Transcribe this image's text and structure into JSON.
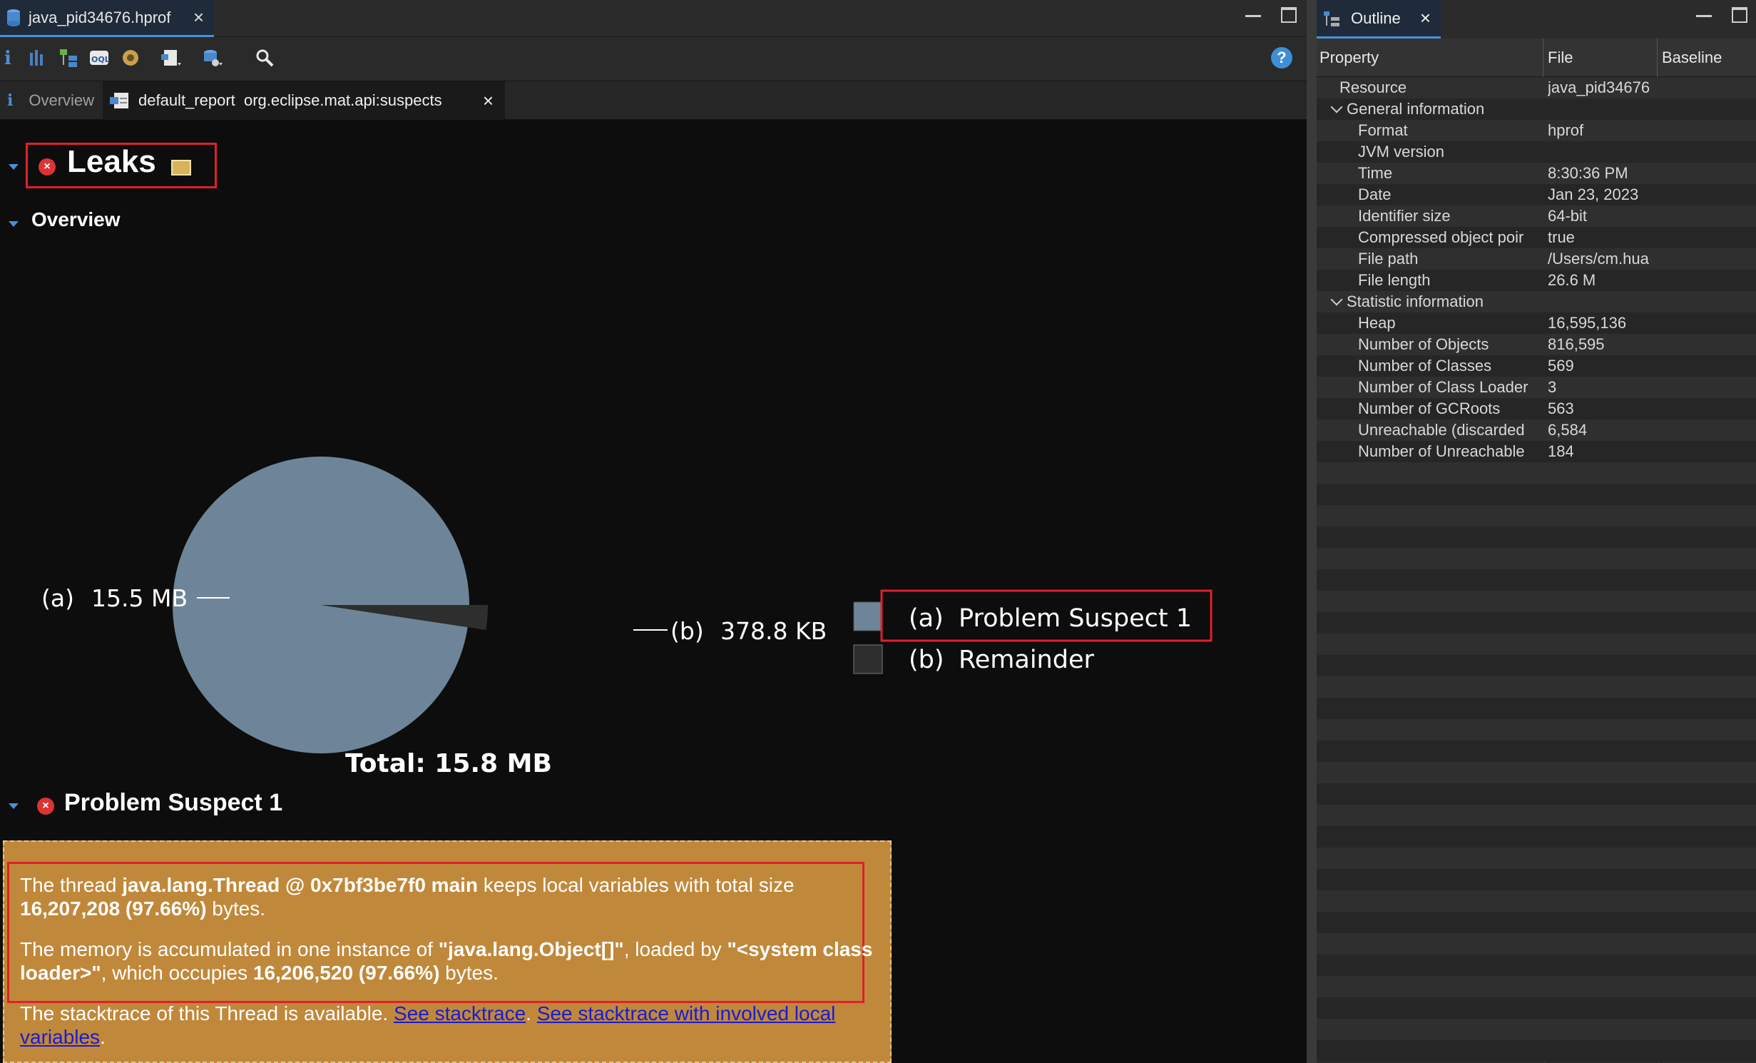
{
  "editor": {
    "file_tab_label": "java_pid34676.hprof",
    "subtabs": {
      "overview_label": "Overview",
      "report_label": "default_report  org.eclipse.mat.api:suspects"
    }
  },
  "report": {
    "leaks_title": "Leaks",
    "overview_heading": "Overview",
    "suspect_heading": "Problem Suspect 1",
    "suspect_text": {
      "p1_pre": "The thread ",
      "p1_thread": "java.lang.Thread @ 0x7bf3be7f0 main",
      "p1_mid": " keeps local variables with total size ",
      "p1_size": "16,207,208 (97.66%)",
      "p1_post": " bytes.",
      "p2_pre": "The memory is accumulated in one instance of ",
      "p2_class": "\"java.lang.Object[]\"",
      "p2_mid": ", loaded by ",
      "p2_loader": "\"<system class loader>\"",
      "p2_mid2": ", which occupies ",
      "p2_size": "16,206,520 (97.66%)",
      "p2_post": " bytes.",
      "p3_pre": "The stacktrace of this Thread is available. ",
      "p3_link1": "See stacktrace",
      "p3_sep": ". ",
      "p3_link2": "See stacktrace with involved local variables",
      "p3_post": "."
    }
  },
  "chart_data": {
    "type": "pie",
    "title": "",
    "total_label": "Total: 15.8 MB",
    "slices": [
      {
        "id": "(a)",
        "value_label": "15.5 MB",
        "value_mb": 15.42,
        "legend": "Problem Suspect 1",
        "color": "#6e8599"
      },
      {
        "id": "(b)",
        "value_label": "378.8 KB",
        "value_mb": 0.378,
        "legend": "Remainder",
        "color": "#2e2e2e"
      }
    ]
  },
  "outline": {
    "tab_label": "Outline",
    "columns": [
      "Property",
      "File",
      "Baseline"
    ],
    "rows": [
      {
        "key": "Resource",
        "value": "java_pid34676",
        "level": 0
      },
      {
        "key": "General information",
        "value": "",
        "level": "group"
      },
      {
        "key": "Format",
        "value": "hprof",
        "level": 1
      },
      {
        "key": "JVM version",
        "value": "",
        "level": 1
      },
      {
        "key": "Time",
        "value": "8:30:36 PM",
        "level": 1
      },
      {
        "key": "Date",
        "value": "Jan 23, 2023",
        "level": 1
      },
      {
        "key": "Identifier size",
        "value": "64-bit",
        "level": 1
      },
      {
        "key": "Compressed object poir",
        "value": "true",
        "level": 1
      },
      {
        "key": "File path",
        "value": "/Users/cm.hua",
        "level": 1
      },
      {
        "key": "File length",
        "value": "26.6 M",
        "level": 1
      },
      {
        "key": "Statistic information",
        "value": "",
        "level": "group"
      },
      {
        "key": "Heap",
        "value": "16,595,136",
        "level": 1
      },
      {
        "key": "Number of Objects",
        "value": "816,595",
        "level": 1
      },
      {
        "key": "Number of Classes",
        "value": "569",
        "level": 1
      },
      {
        "key": "Number of Class Loader",
        "value": "3",
        "level": 1
      },
      {
        "key": "Number of GCRoots",
        "value": "563",
        "level": 1
      },
      {
        "key": "Unreachable (discarded",
        "value": "6,584",
        "level": 1
      },
      {
        "key": "Number of Unreachable",
        "value": "184",
        "level": 1
      }
    ]
  },
  "colors": {
    "accent": "#4a90d9",
    "highlight_border": "#e0202a",
    "suspect_bg": "#c0883a"
  }
}
